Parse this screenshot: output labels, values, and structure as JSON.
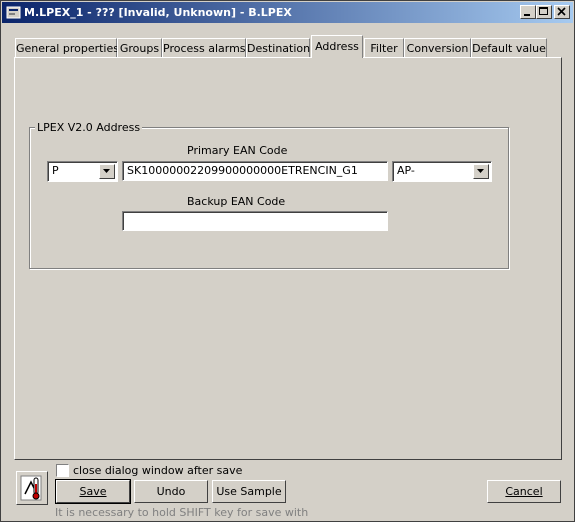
{
  "window": {
    "title": "M.LPEX_1 - ??? [Invalid, Unknown] - B.LPEX"
  },
  "tabs": [
    {
      "label": "General properties",
      "active": false
    },
    {
      "label": "Groups",
      "active": false
    },
    {
      "label": "Process alarms",
      "active": false
    },
    {
      "label": "Destination",
      "active": false
    },
    {
      "label": "Address",
      "active": true
    },
    {
      "label": "Filter",
      "active": false
    },
    {
      "label": "Conversion",
      "active": false
    },
    {
      "label": "Default value",
      "active": false
    }
  ],
  "address": {
    "group_title": "LPEX V2.0 Address",
    "primary_label": "Primary EAN Code",
    "prefix_value": "P",
    "primary_value": "SK10000002209900000000ETRENCIN_G1",
    "suffix_value": "AP-",
    "backup_label": "Backup EAN Code",
    "backup_value": ""
  },
  "footer": {
    "close_after_save_label": "close dialog window after save",
    "close_after_save_checked": false,
    "save_label": "Save",
    "undo_label": "Undo",
    "use_sample_label": "Use Sample",
    "cancel_label": "Cancel",
    "hint": "It is necessary to hold SHIFT key for save with"
  },
  "icons": {
    "title": "dialog-app-icon",
    "footer": "thermometer-icon"
  }
}
